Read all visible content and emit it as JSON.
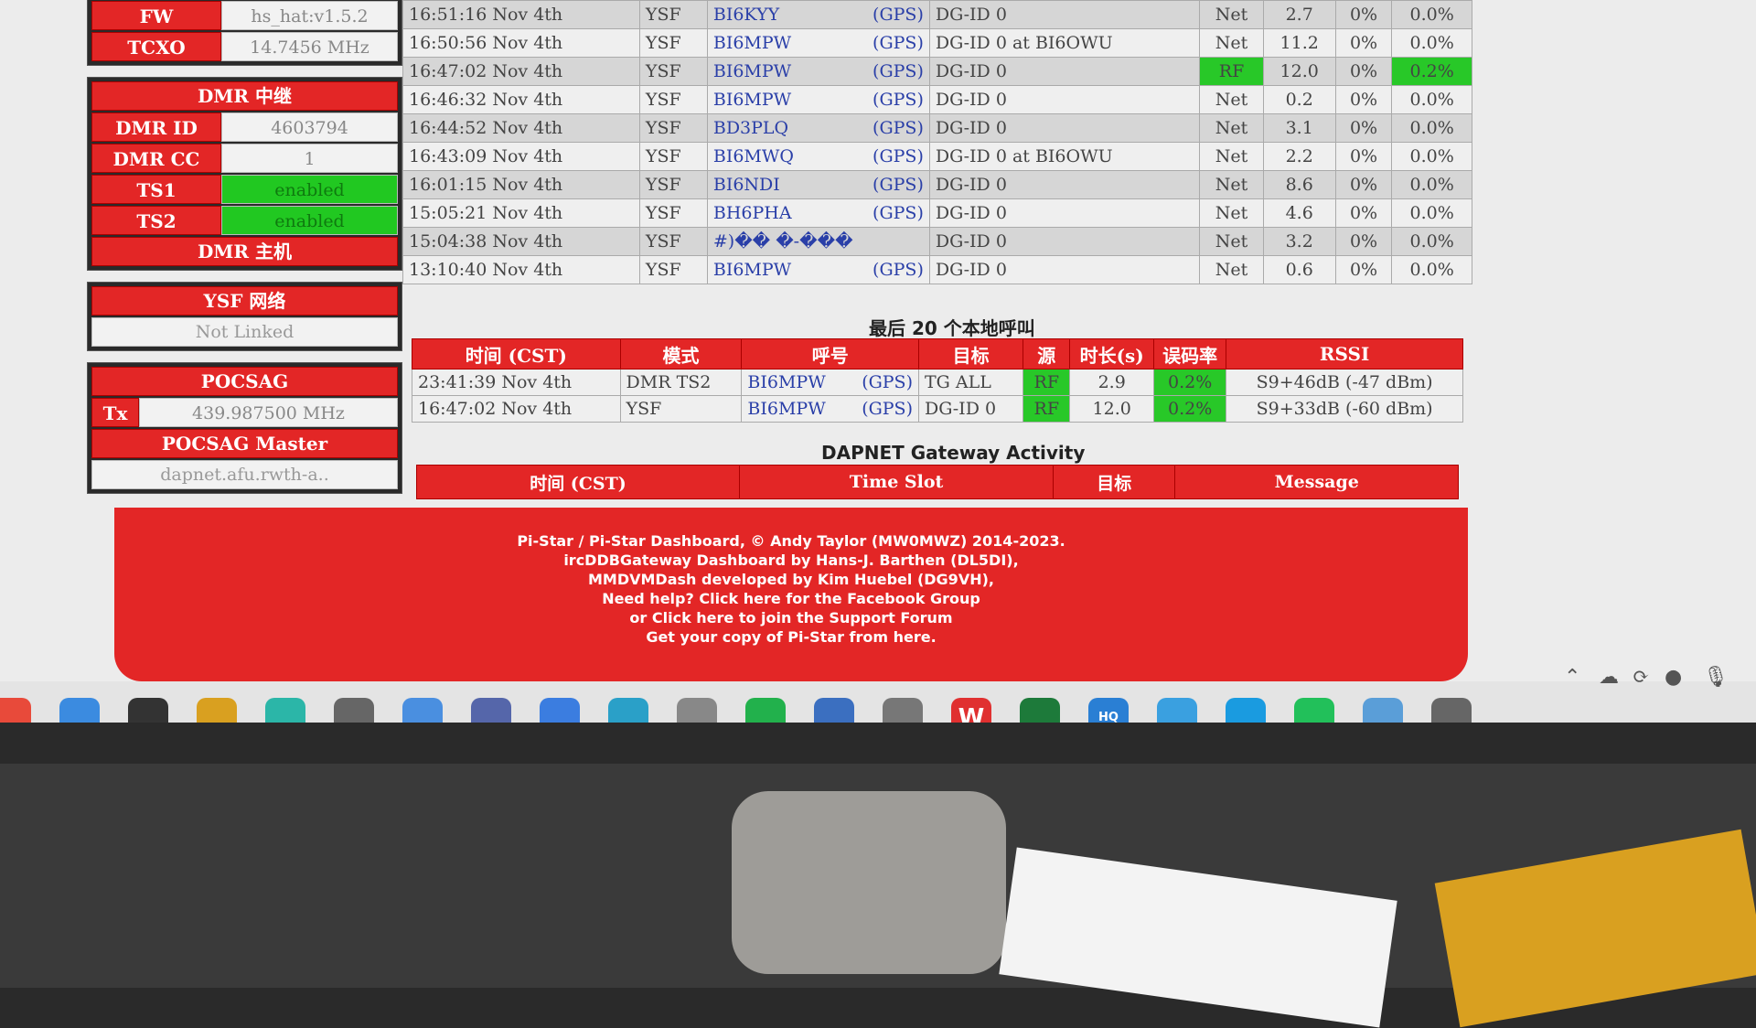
{
  "left": {
    "top_partial": {
      "label": "FW",
      "value": "hs_hat:v1.5.2"
    },
    "tcxo": {
      "label": "TCXO",
      "value": "14.7456 MHz"
    },
    "dmr_repeater": {
      "title": "DMR 中继",
      "rows": [
        {
          "label": "DMR ID",
          "value": "4603794"
        },
        {
          "label": "DMR CC",
          "value": "1"
        },
        {
          "label": "TS1",
          "value": "enabled"
        },
        {
          "label": "TS2",
          "value": "enabled"
        }
      ],
      "master_title": "DMR 主机"
    },
    "ysf": {
      "title": "YSF 网络",
      "value": "Not Linked"
    },
    "pocsag": {
      "title": "POCSAG",
      "tx_label": "Tx",
      "tx_value": "439.987500 MHz",
      "master_title": "POCSAG Master",
      "master_value": "dapnet.afu.rwth-a.."
    }
  },
  "history": [
    {
      "time": "16:51:16 Nov 4th",
      "mode": "YSF",
      "call": "BI6KYY",
      "gps": "(GPS)",
      "target": "DG-ID  0",
      "src": "Net",
      "dur": "2.7",
      "loss": "0%",
      "ber": "0.0%"
    },
    {
      "time": "16:50:56 Nov 4th",
      "mode": "YSF",
      "call": "BI6MPW",
      "gps": "(GPS)",
      "target": "DG-ID  0  at  BI6OWU",
      "src": "Net",
      "dur": "11.2",
      "loss": "0%",
      "ber": "0.0%"
    },
    {
      "time": "16:47:02 Nov 4th",
      "mode": "YSF",
      "call": "BI6MPW",
      "gps": "(GPS)",
      "target": "DG-ID  0",
      "src": "RF",
      "dur": "12.0",
      "loss": "0%",
      "ber": "0.2%"
    },
    {
      "time": "16:46:32 Nov 4th",
      "mode": "YSF",
      "call": "BI6MPW",
      "gps": "(GPS)",
      "target": "DG-ID  0",
      "src": "Net",
      "dur": "0.2",
      "loss": "0%",
      "ber": "0.0%"
    },
    {
      "time": "16:44:52 Nov 4th",
      "mode": "YSF",
      "call": "BD3PLQ",
      "gps": "(GPS)",
      "target": "DG-ID  0",
      "src": "Net",
      "dur": "3.1",
      "loss": "0%",
      "ber": "0.0%"
    },
    {
      "time": "16:43:09 Nov 4th",
      "mode": "YSF",
      "call": "BI6MWQ",
      "gps": "(GPS)",
      "target": "DG-ID  0  at  BI6OWU",
      "src": "Net",
      "dur": "2.2",
      "loss": "0%",
      "ber": "0.0%"
    },
    {
      "time": "16:01:15 Nov 4th",
      "mode": "YSF",
      "call": "BI6NDI",
      "gps": "(GPS)",
      "target": "DG-ID  0",
      "src": "Net",
      "dur": "8.6",
      "loss": "0%",
      "ber": "0.0%"
    },
    {
      "time": "15:05:21 Nov 4th",
      "mode": "YSF",
      "call": "BH6PHA",
      "gps": "(GPS)",
      "target": "DG-ID  0",
      "src": "Net",
      "dur": "4.6",
      "loss": "0%",
      "ber": "0.0%"
    },
    {
      "time": "15:04:38 Nov 4th",
      "mode": "YSF",
      "call": "#)��  �-���",
      "gps": "",
      "target": "DG-ID  0",
      "src": "Net",
      "dur": "3.2",
      "loss": "0%",
      "ber": "0.0%"
    },
    {
      "time": "13:10:40 Nov 4th",
      "mode": "YSF",
      "call": "BI6MPW",
      "gps": "(GPS)",
      "target": "DG-ID  0",
      "src": "Net",
      "dur": "0.6",
      "loss": "0%",
      "ber": "0.0%"
    }
  ],
  "local": {
    "title": "最后 20 个本地呼叫",
    "headers": [
      "时间 (CST)",
      "模式",
      "呼号",
      "目标",
      "源",
      "时长(s)",
      "误码率",
      "RSSI"
    ],
    "rows": [
      {
        "time": "23:41:39 Nov 4th",
        "mode": "DMR TS2",
        "call": "BI6MPW",
        "gps": "(GPS)",
        "target": "TG  ALL",
        "src": "RF",
        "dur": "2.9",
        "ber": "0.2%",
        "rssi": "S9+46dB (-47 dBm)"
      },
      {
        "time": "16:47:02 Nov 4th",
        "mode": "YSF",
        "call": "BI6MPW",
        "gps": "(GPS)",
        "target": "DG-ID  0",
        "src": "RF",
        "dur": "12.0",
        "ber": "0.2%",
        "rssi": "S9+33dB (-60 dBm)"
      }
    ]
  },
  "dapnet": {
    "title": "DAPNET Gateway Activity",
    "headers": [
      "时间 (CST)",
      "Time Slot",
      "目标",
      "Message"
    ]
  },
  "footer": [
    "Pi-Star / Pi-Star Dashboard, © Andy Taylor (MW0MWZ) 2014-2023.",
    "ircDDBGateway Dashboard by Hans-J. Barthen (DL5DI),",
    "MMDVMDash developed by Kim Huebel (DG9VH),",
    "Need help? Click here for the Facebook Group",
    "or Click here to join the Support Forum",
    "Get your copy of Pi-Star from here."
  ],
  "taskbar": {
    "icons": [
      "chrome-icon",
      "cloud-pro-icon",
      "terminal-icon",
      "winrar-icon",
      "infinity-icon",
      "camera-icon",
      "cloud-sync-icon",
      "chemistry-icon",
      "notepad-icon",
      "chatgpt-icon",
      "reader-icon",
      "wechat-icon",
      "tablet-icon",
      "drone-icon",
      "wps-icon",
      "excel-icon",
      "hq-dfm-icon",
      "photos-icon",
      "edge-icon",
      "messenger-icon",
      "monitor-icon",
      "settings-icon"
    ],
    "hq_label": "HQ DFM",
    "wps_label": "W"
  },
  "colors": {
    "accent": "#e32626",
    "green": "#28c828"
  }
}
